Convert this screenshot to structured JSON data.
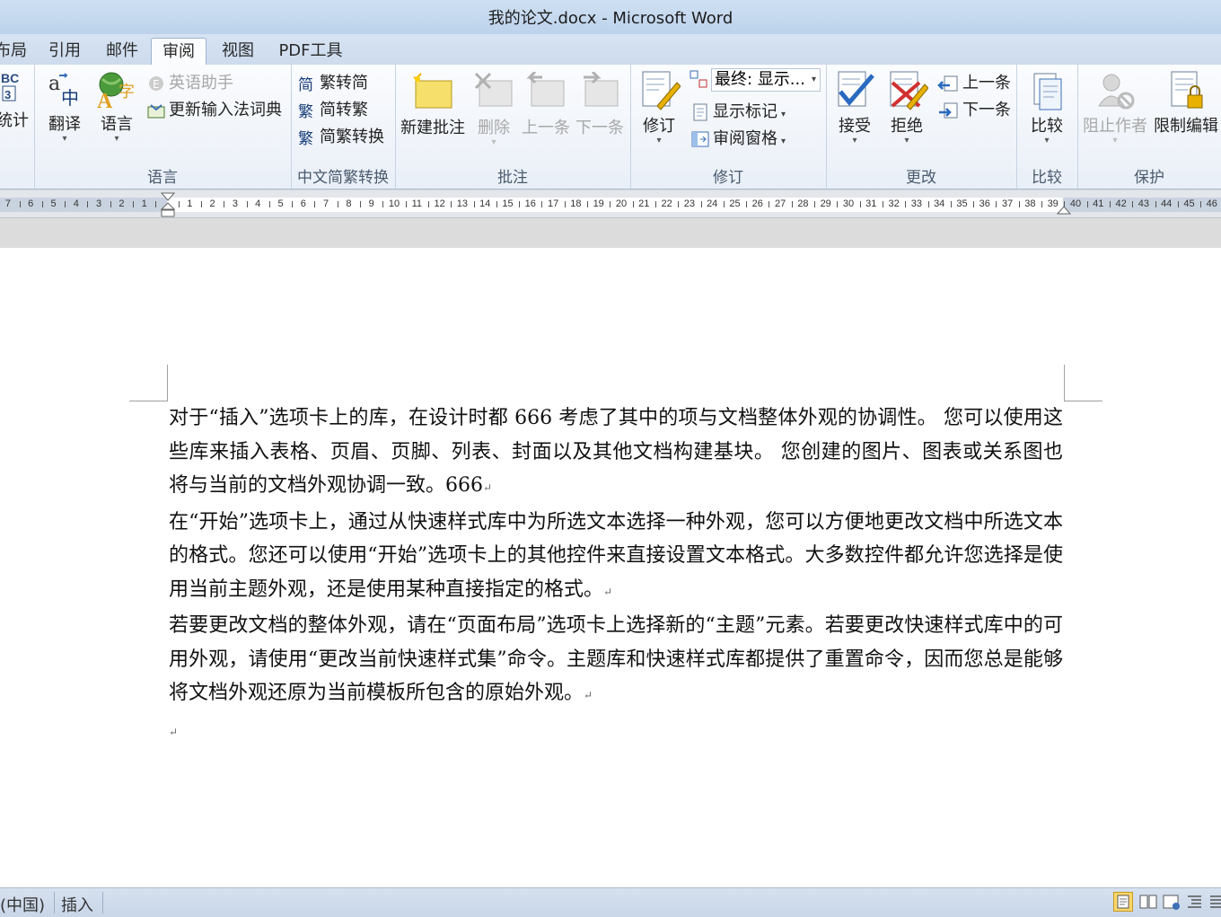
{
  "window": {
    "title": "我的论文.docx - Microsoft Word"
  },
  "tabs": [
    {
      "label": "布局",
      "active": false
    },
    {
      "label": "引用",
      "active": false
    },
    {
      "label": "邮件",
      "active": false
    },
    {
      "label": "审阅",
      "active": true
    },
    {
      "label": "视图",
      "active": false
    },
    {
      "label": "PDF工具",
      "active": false
    }
  ],
  "ribbon": {
    "proofing": {
      "word_count_label": "统计"
    },
    "language": {
      "label": "语言",
      "translate": "翻译",
      "language_btn": "语言",
      "english_assistant": "英语助手",
      "update_ime": "更新输入法词典"
    },
    "chinese_conversion": {
      "label": "中文简繁转换",
      "to_simplified": "繁转简",
      "to_traditional": "简转繁",
      "conversion": "简繁转换"
    },
    "comments": {
      "label": "批注",
      "new_comment": "新建批注",
      "delete": "删除",
      "previous": "上一条",
      "next": "下一条"
    },
    "tracking": {
      "label": "修订",
      "track_changes": "修订",
      "display_select": "最终: 显示...",
      "show_markup": "显示标记",
      "review_pane": "审阅窗格"
    },
    "changes": {
      "label": "更改",
      "accept": "接受",
      "reject": "拒绝",
      "previous": "上一条",
      "next": "下一条"
    },
    "compare": {
      "label": "比较",
      "compare_btn": "比较"
    },
    "protect": {
      "label": "保护",
      "block_authors": "阻止作者",
      "restrict_editing": "限制编辑"
    }
  },
  "ruler": {
    "left_numbers": [
      "7",
      "6",
      "5",
      "4",
      "3",
      "2",
      "1"
    ],
    "right_numbers": [
      "1",
      "2",
      "3",
      "4",
      "5",
      "6",
      "7",
      "8",
      "9",
      "10",
      "11",
      "12",
      "13",
      "14",
      "15",
      "16",
      "17",
      "18",
      "19",
      "20",
      "21",
      "22",
      "23",
      "24",
      "25",
      "26",
      "27",
      "28",
      "29",
      "30",
      "31",
      "32",
      "33",
      "34",
      "35",
      "36",
      "37",
      "38",
      "39",
      "40",
      "41",
      "42",
      "43",
      "44",
      "45",
      "46"
    ]
  },
  "document": {
    "paragraphs": [
      "对于“插入”选项卡上的库，在设计时都 666 考虑了其中的项与文档整体外观的协调性。 您可以使用这些库来插入表格、页眉、页脚、列表、封面以及其他文档构建基块。 您创建的图片、图表或关系图也将与当前的文档外观协调一致。666",
      "在“开始”选项卡上，通过从快速样式库中为所选文本选择一种外观，您可以方便地更改文档中所选文本的格式。您还可以使用“开始”选项卡上的其他控件来直接设置文本格式。大多数控件都允许您选择是使用当前主题外观，还是使用某种直接指定的格式。",
      "若要更改文档的整体外观，请在“页面布局”选项卡上选择新的“主题”元素。若要更改快速样式库中的可用外观，请使用“更改当前快速样式集”命令。主题库和快速样式库都提供了重置命令，因而您总是能够将文档外观还原为当前模板所包含的原始外观。"
    ],
    "paragraph_mark": "↵"
  },
  "statusbar": {
    "language": "(中国)",
    "insert_mode": "插入"
  },
  "colors": {
    "titlebar": "#bcd2ec",
    "ribbon_bg": "#f4f7fb",
    "accent": "#3b6fb6"
  }
}
